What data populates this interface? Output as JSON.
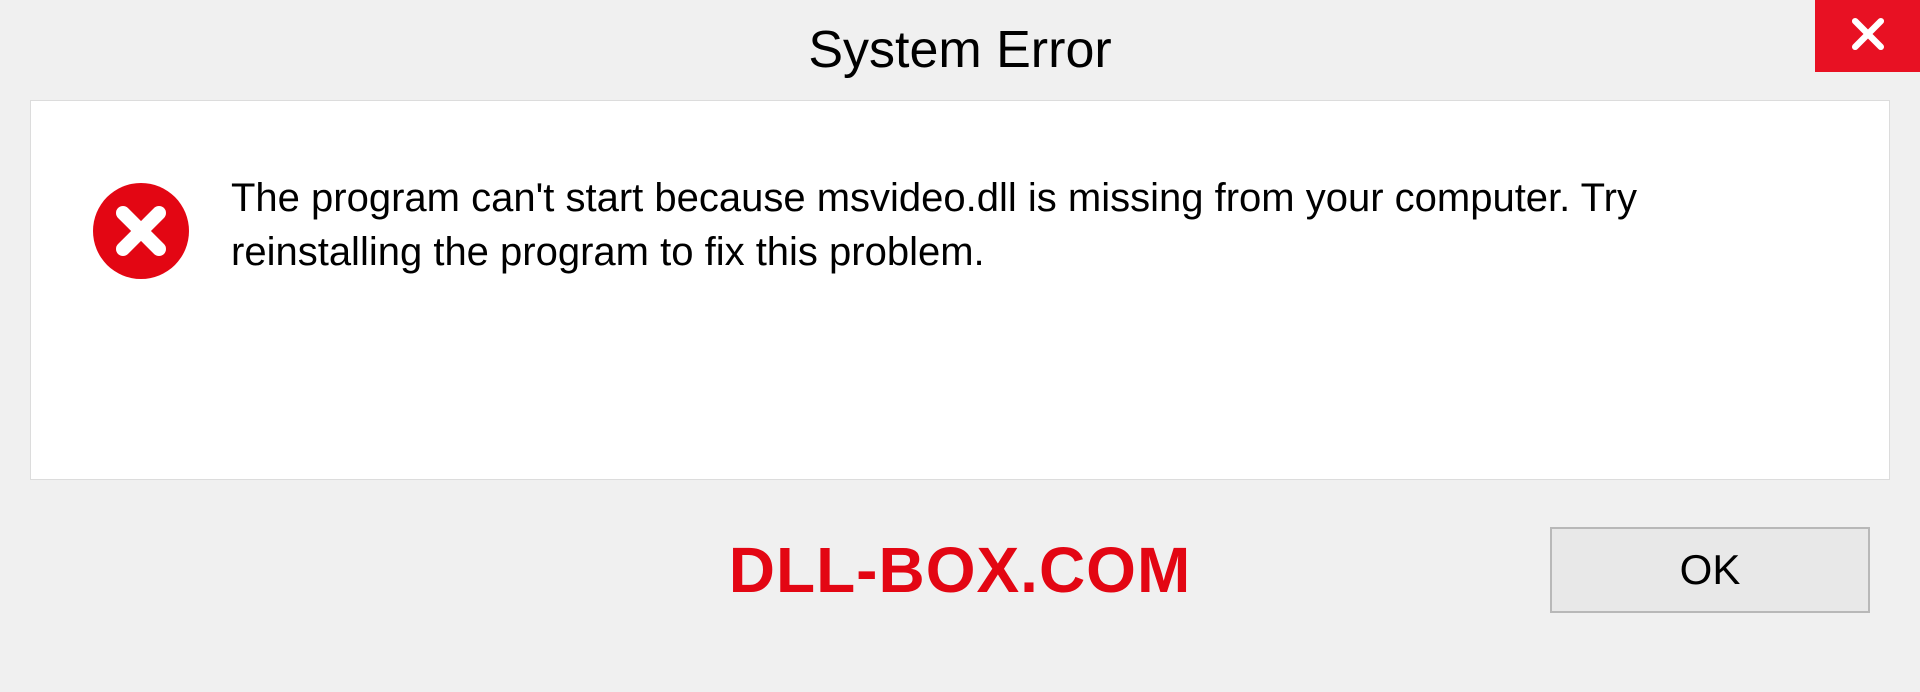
{
  "dialog": {
    "title": "System Error",
    "message": "The program can't start because msvideo.dll is missing from your computer. Try reinstalling the program to fix this problem.",
    "ok_label": "OK"
  },
  "watermark": "DLL-BOX.COM",
  "colors": {
    "close_bg": "#e81123",
    "error_icon": "#e30613",
    "watermark": "#e30613"
  }
}
